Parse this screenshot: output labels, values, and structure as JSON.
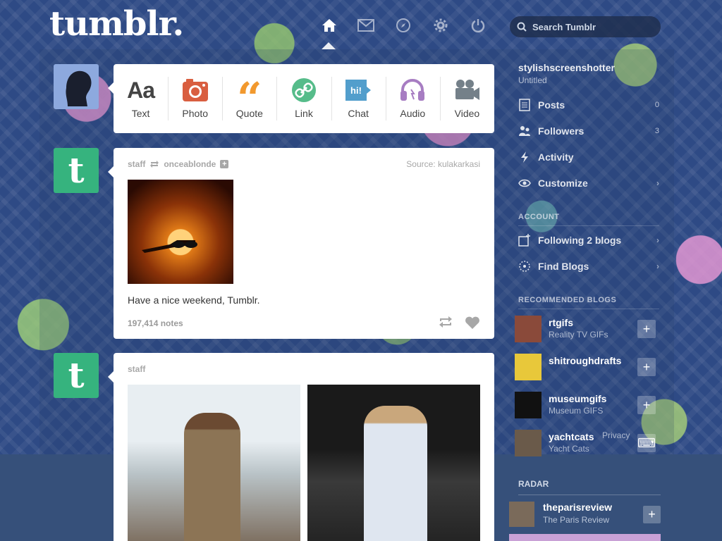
{
  "header": {
    "logo": "tumblr.",
    "nav": [
      {
        "name": "home-icon",
        "active": true
      },
      {
        "name": "inbox-icon",
        "active": false
      },
      {
        "name": "explore-icon",
        "active": false
      },
      {
        "name": "settings-icon",
        "active": false
      },
      {
        "name": "logout-icon",
        "active": false
      }
    ],
    "search_placeholder": "Search Tumblr"
  },
  "composer": {
    "types": [
      {
        "label": "Text",
        "icon": "text-icon",
        "color": "#444444"
      },
      {
        "label": "Photo",
        "icon": "camera-icon",
        "color": "#d95e40"
      },
      {
        "label": "Quote",
        "icon": "quote-icon",
        "color": "#f2992e"
      },
      {
        "label": "Link",
        "icon": "link-icon",
        "color": "#56bc8a"
      },
      {
        "label": "Chat",
        "icon": "chat-icon",
        "color": "#529ecc"
      },
      {
        "label": "Audio",
        "icon": "headphones-icon",
        "color": "#a77dc2"
      },
      {
        "label": "Video",
        "icon": "video-camera-icon",
        "color": "#748089"
      }
    ]
  },
  "posts": [
    {
      "author": "staff",
      "reblogged_from": "onceablonde",
      "source_label": "Source:",
      "source": "kulakarkasi",
      "caption": "Have a nice weekend, Tumblr.",
      "notes": "197,414 notes"
    },
    {
      "author": "staff"
    }
  ],
  "sidebar": {
    "blog_name": "stylishscreenshotter",
    "blog_title": "Untitled",
    "menu": [
      {
        "label": "Posts",
        "count": "0",
        "icon": "posts-icon"
      },
      {
        "label": "Followers",
        "count": "3",
        "icon": "followers-icon"
      },
      {
        "label": "Activity",
        "count": "",
        "icon": "activity-icon"
      },
      {
        "label": "Customize",
        "count": "",
        "icon": "eye-icon"
      }
    ],
    "account_heading": "ACCOUNT",
    "account": [
      {
        "label": "Following 2 blogs",
        "icon": "following-icon"
      },
      {
        "label": "Find Blogs",
        "icon": "find-blogs-icon"
      }
    ],
    "recommended_heading": "RECOMMENDED BLOGS",
    "recommended": [
      {
        "name": "rtgifs",
        "title": "Reality TV GIFs",
        "thumb_color": "#8a4a3a"
      },
      {
        "name": "shitroughdrafts",
        "title": "",
        "thumb_color": "#e8c83a"
      },
      {
        "name": "museumgifs",
        "title": "Museum GIFS",
        "thumb_color": "#111111"
      },
      {
        "name": "yachtcats",
        "title": "Yacht Cats",
        "thumb_color": "#6a5a4a"
      }
    ],
    "privacy": "Privacy",
    "radar_heading": "RADAR",
    "radar": {
      "name": "theparisreview",
      "title": "The Paris Review"
    }
  },
  "colors": {
    "staff_green": "#36b37e",
    "background_blue": "#2e4a85"
  }
}
